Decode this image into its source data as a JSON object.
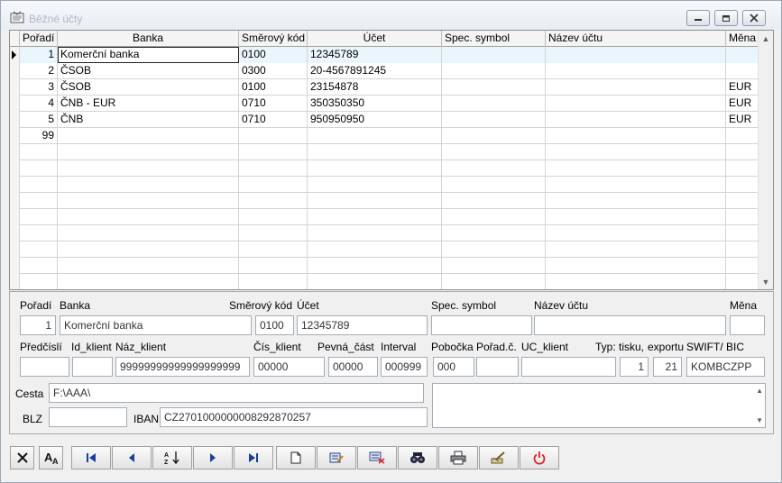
{
  "window": {
    "title": "Běžné účty"
  },
  "grid": {
    "columns": [
      "Pořadí",
      "Banka",
      "Směrový kód",
      "Účet",
      "Spec. symbol",
      "Název účtu",
      "Měna"
    ],
    "rows": [
      {
        "poradi": "1",
        "banka": "Komerční banka",
        "kod": "0100",
        "ucet": "12345789",
        "spec": "",
        "nazev": "",
        "mena": ""
      },
      {
        "poradi": "2",
        "banka": "ČSOB",
        "kod": "0300",
        "ucet": "20-4567891245",
        "spec": "",
        "nazev": "",
        "mena": ""
      },
      {
        "poradi": "3",
        "banka": "ČSOB",
        "kod": "0100",
        "ucet": "23154878",
        "spec": "",
        "nazev": "",
        "mena": "EUR"
      },
      {
        "poradi": "4",
        "banka": "ČNB - EUR",
        "kod": "0710",
        "ucet": "350350350",
        "spec": "",
        "nazev": "",
        "mena": "EUR"
      },
      {
        "poradi": "5",
        "banka": "ČNB",
        "kod": "0710",
        "ucet": "950950950",
        "spec": "",
        "nazev": "",
        "mena": "EUR"
      },
      {
        "poradi": "99",
        "banka": "",
        "kod": "",
        "ucet": "",
        "spec": "",
        "nazev": "",
        "mena": ""
      }
    ]
  },
  "detail": {
    "labels": {
      "poradi": "Pořadí",
      "banka": "Banka",
      "kod": "Směrový kód",
      "ucet": "Účet",
      "spec": "Spec. symbol",
      "nazev": "Název účtu",
      "mena": "Měna",
      "predcisli": "Předčíslí",
      "id_klient": "Id_klient",
      "naz_klient": "Náz_klient",
      "cis_klient": "Čís_klient",
      "pevna_cast": "Pevná_část",
      "interval": "Interval",
      "pobocka": "Pobočka",
      "porad_c": "Pořad.č.",
      "uc_klient": "UC_klient",
      "typ_tisku": "Typ: tisku,",
      "exportu": "exportu",
      "swift": "SWIFT/ BIC",
      "cesta": "Cesta",
      "blz": "BLZ",
      "iban": "IBAN"
    },
    "values": {
      "poradi": "1",
      "banka": "Komerční banka",
      "kod": "0100",
      "ucet": "12345789",
      "spec": "",
      "nazev": "",
      "mena": "",
      "predcisli": "",
      "id_klient": "",
      "naz_klient": "99999999999999999999",
      "cis_klient": "00000",
      "pevna_cast": "00000",
      "interval": "000999",
      "pobocka": "000",
      "porad_c": "",
      "uc_klient": "",
      "typ_tisku": "1",
      "exportu": "21",
      "swift": "KOMBCZPP",
      "cesta": "F:\\AAA\\",
      "blz": "",
      "iban": "CZ2701000000008292870257"
    }
  },
  "toolbar": {
    "buttons": [
      "close",
      "font",
      "first",
      "prev",
      "sort",
      "next",
      "last",
      "new",
      "edit",
      "delete",
      "find",
      "print",
      "tools",
      "power"
    ]
  },
  "colors": {
    "accent_red": "#e02020",
    "nav_blue": "#1a3fa0"
  }
}
